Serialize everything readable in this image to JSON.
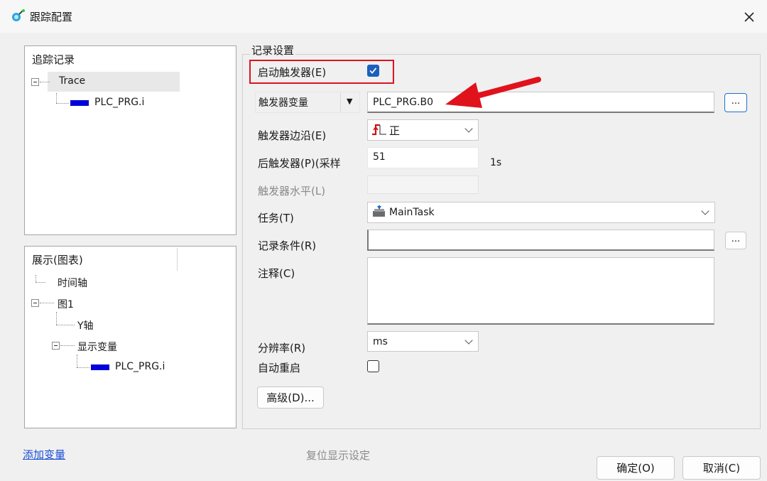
{
  "window": {
    "title": "跟踪配置"
  },
  "trace_tree": {
    "header": "追踪记录",
    "items": [
      {
        "label": "Trace"
      },
      {
        "label": "PLC_PRG.i"
      }
    ]
  },
  "display_tree": {
    "header": "展示(图表)",
    "items": [
      {
        "label": "时间轴"
      },
      {
        "label": "图1"
      },
      {
        "label": "Y轴"
      },
      {
        "label": "显示变量"
      },
      {
        "label": "PLC_PRG.i"
      }
    ]
  },
  "record_settings": {
    "group_title": "记录设置",
    "enable_trigger": {
      "label": "启动触发器(E)",
      "checked": true
    },
    "trigger_variable": {
      "dropdown_label": "触发器变量",
      "value": "PLC_PRG.B0",
      "browse": "..."
    },
    "trigger_edge": {
      "label": "触发器边沿(E)",
      "value": "正"
    },
    "post_trigger": {
      "label": "后触发器(P)(采样",
      "value": "51",
      "unit": "1s"
    },
    "trigger_level": {
      "label": "触发器水平(L)",
      "value": ""
    },
    "task": {
      "label": "任务(T)",
      "value": "MainTask"
    },
    "record_condition": {
      "label": "记录条件(R)",
      "value": "",
      "browse": "..."
    },
    "comment": {
      "label": "注释(C)",
      "value": ""
    },
    "resolution": {
      "label": "分辨率(R)",
      "value": "ms"
    },
    "auto_restart": {
      "label": "自动重启",
      "checked": false
    },
    "advanced_button": "高级(D)..."
  },
  "footer": {
    "add_variable": "添加变量",
    "reset_display": "复位显示设定",
    "ok": "确定(O)",
    "cancel": "取消(C)"
  },
  "colors": {
    "highlight_box": "#e0121c",
    "arrow": "#e0121c",
    "variable_swatch": "#0000d8",
    "checkbox_checked": "#1c5fbf"
  }
}
